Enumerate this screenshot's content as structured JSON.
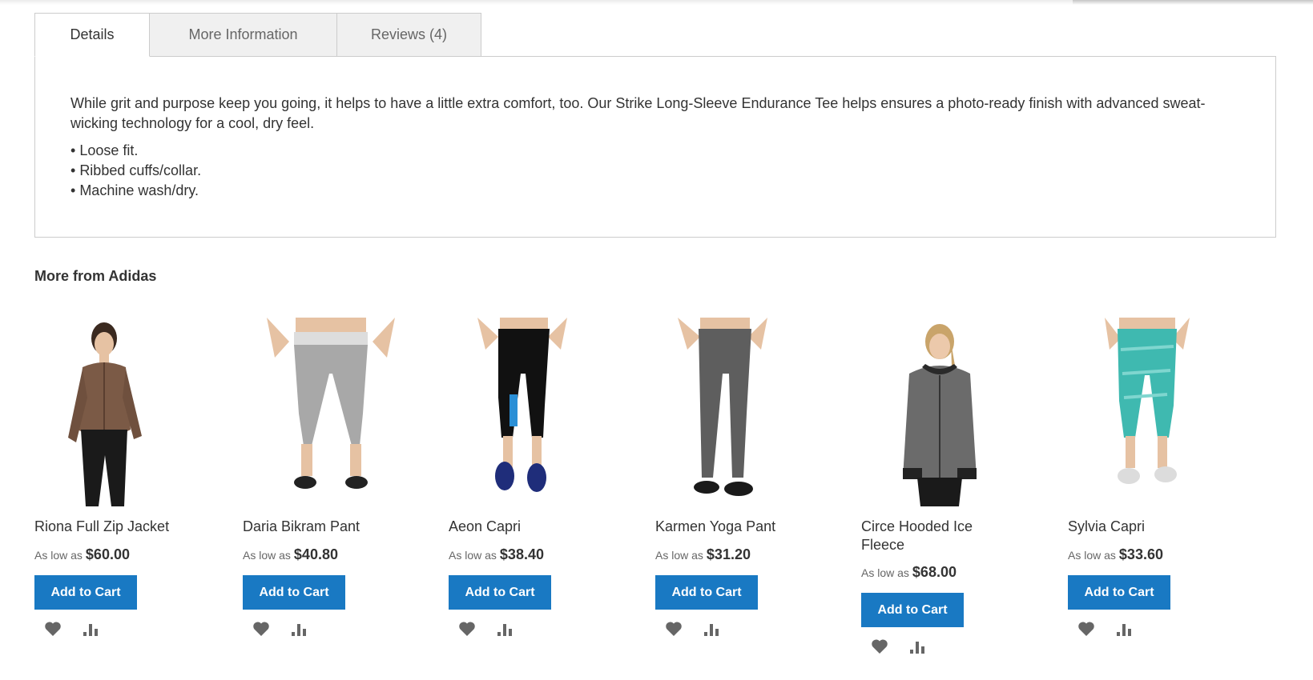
{
  "tabs": [
    {
      "label": "Details",
      "active": true
    },
    {
      "label": "More Information",
      "active": false
    },
    {
      "label": "Reviews (4)",
      "active": false
    }
  ],
  "details": {
    "description": "While grit and purpose keep you going, it helps to have a little extra comfort, too. Our Strike Long-Sleeve Endurance Tee helps ensures a photo-ready finish with advanced sweat-wicking technology for a cool, dry feel.",
    "features": [
      "Loose fit.",
      "Ribbed cuffs/collar.",
      "Machine wash/dry."
    ]
  },
  "related": {
    "title": "More from Adidas",
    "price_prefix": "As low as",
    "add_to_cart_label": "Add to Cart",
    "wishlist_icon": "heart-icon",
    "compare_icon": "bar-chart-icon",
    "products": [
      {
        "name": "Riona Full Zip Jacket",
        "price": "$60.00",
        "image": "woman-brown-zip-jacket"
      },
      {
        "name": "Daria Bikram Pant",
        "price": "$40.80",
        "image": "gray-capri-leggings"
      },
      {
        "name": "Aeon Capri",
        "price": "$38.40",
        "image": "black-blue-capri"
      },
      {
        "name": "Karmen Yoga Pant",
        "price": "$31.20",
        "image": "gray-yoga-pant"
      },
      {
        "name": "Circe Hooded Ice Fleece",
        "price": "$68.00",
        "image": "woman-gray-hoodie"
      },
      {
        "name": "Sylvia Capri",
        "price": "$33.60",
        "image": "teal-capri"
      }
    ]
  },
  "colors": {
    "button": "#1979c3",
    "tab_inactive_bg": "#f0f0f0",
    "border": "#cccccc",
    "icon": "#666666"
  }
}
